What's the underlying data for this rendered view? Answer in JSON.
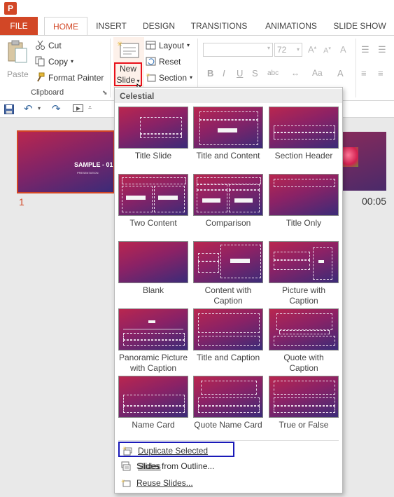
{
  "app": {
    "icon_letter": "P"
  },
  "tabs": [
    {
      "label": "FILE"
    },
    {
      "label": "HOME"
    },
    {
      "label": "INSERT"
    },
    {
      "label": "DESIGN"
    },
    {
      "label": "TRANSITIONS"
    },
    {
      "label": "ANIMATIONS"
    },
    {
      "label": "SLIDE SHOW"
    }
  ],
  "clipboard": {
    "paste": "Paste",
    "cut": "Cut",
    "copy": "Copy",
    "format_painter": "Format Painter",
    "group_label": "Clipboard"
  },
  "slides": {
    "new_slide_line1": "New",
    "new_slide_line2": "Slide",
    "layout": "Layout",
    "reset": "Reset",
    "section": "Section"
  },
  "font": {
    "size": "72"
  },
  "format_buttons": [
    "B",
    "I",
    "U",
    "S",
    "abc",
    "A"
  ],
  "thumbnails": [
    {
      "number": "1",
      "title": "SAMPLE - 01",
      "subtitle": "PRESENTATION"
    }
  ],
  "timing": "00:05",
  "dropdown": {
    "theme_name": "Celestial",
    "layouts": [
      {
        "label": "Title Slide"
      },
      {
        "label": "Title and Content"
      },
      {
        "label": "Section Header"
      },
      {
        "label": "Two Content"
      },
      {
        "label": "Comparison"
      },
      {
        "label": "Title Only"
      },
      {
        "label": "Blank"
      },
      {
        "label": "Content with Caption"
      },
      {
        "label": "Picture with Caption"
      },
      {
        "label": "Panoramic Picture with Caption"
      },
      {
        "label": "Title and Caption"
      },
      {
        "label": "Quote with Caption"
      },
      {
        "label": "Name Card"
      },
      {
        "label": "Quote Name Card"
      },
      {
        "label": "True or False"
      }
    ],
    "menu_items": [
      {
        "label": "Duplicate Selected Slides"
      },
      {
        "label": "Slides from Outline..."
      },
      {
        "label": "Reuse Slides..."
      }
    ]
  },
  "colors": {
    "accent": "#d24726",
    "highlight_red": "#e8101a",
    "highlight_blue": "#1a1ab8"
  }
}
